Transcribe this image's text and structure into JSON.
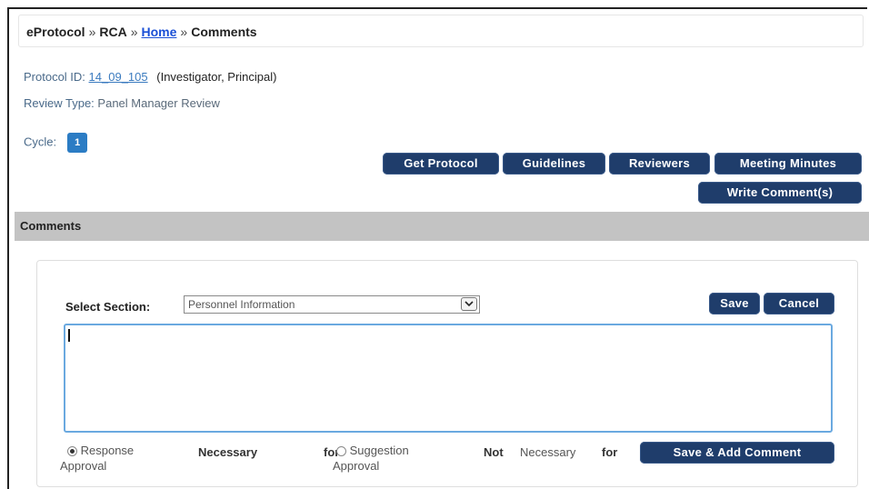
{
  "breadcrumb": {
    "items": [
      "eProtocol",
      "RCA",
      "Home",
      "Comments"
    ],
    "separator": "»"
  },
  "protocol": {
    "id_label": "Protocol ID:",
    "id_value": "14_09_105",
    "role": "(Investigator, Principal)",
    "review_type_label": "Review Type:",
    "review_type_value": "Panel Manager Review",
    "cycle_label": "Cycle:",
    "cycle_value": "1"
  },
  "toolbar": {
    "get_protocol": "Get Protocol",
    "guidelines": "Guidelines",
    "reviewers": "Reviewers",
    "meeting_minutes": "Meeting Minutes",
    "write_comments": "Write Comment(s)"
  },
  "comments": {
    "section_title": "Comments",
    "select_label": "Select Section:",
    "select_value": "Personnel Information",
    "save": "Save",
    "cancel": "Cancel",
    "textarea_value": "",
    "save_add": "Save & Add Comment",
    "radio_response_text1": "Response",
    "radio_response_text2": "Necessary",
    "radio_response_text3": "for",
    "radio_response_text4": "Approval",
    "radio_suggestion_text1": "Suggestion",
    "radio_suggestion_text2": "Not",
    "radio_suggestion_text3": "Necessary",
    "radio_suggestion_text4": "for",
    "radio_suggestion_text5": "Approval"
  },
  "colors": {
    "button_bg": "#1f3d6b",
    "link": "#1a4fd6",
    "cycle_badge": "#2b7cc4",
    "section_bar": "#c3c3c3",
    "textarea_focus": "#6aa9e0"
  }
}
